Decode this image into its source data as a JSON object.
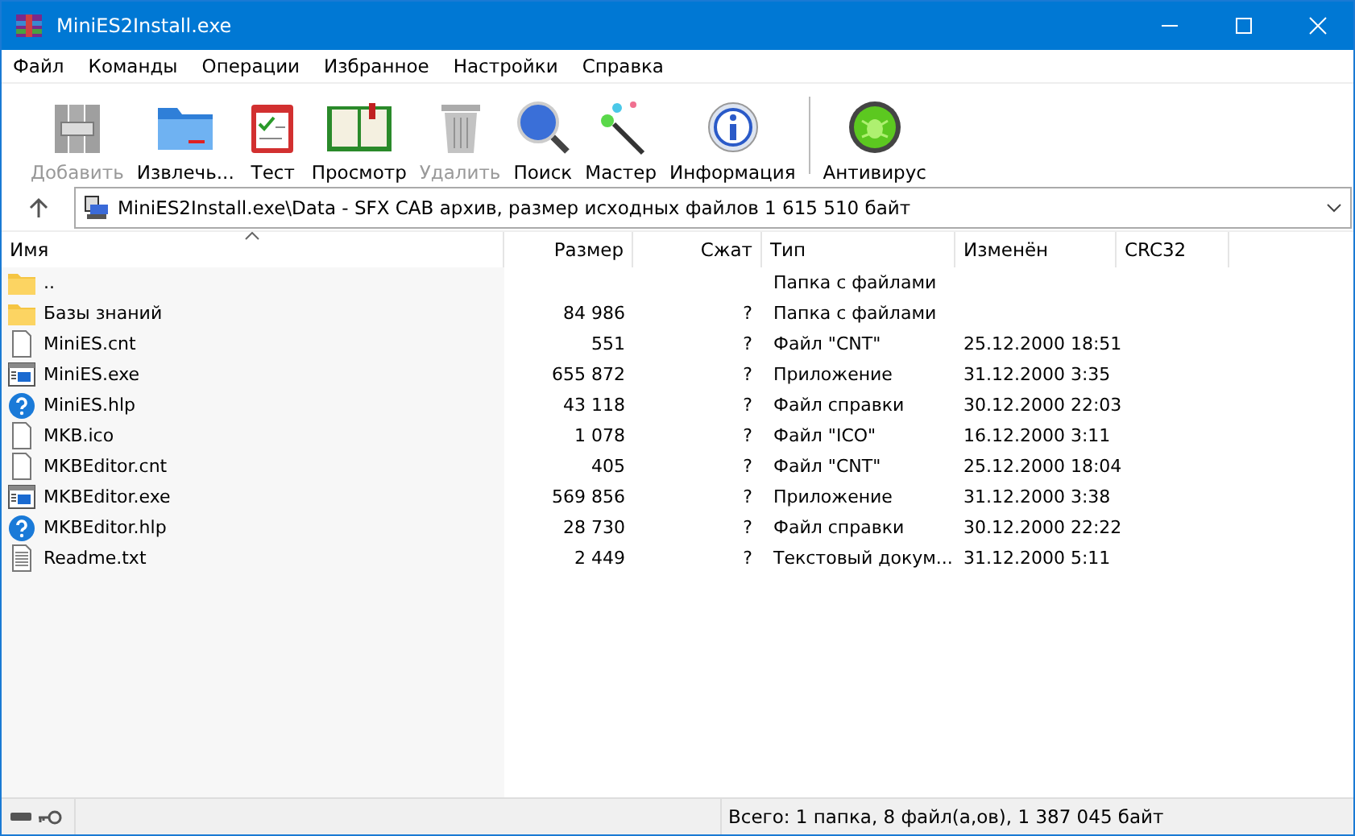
{
  "window": {
    "title": "MiniES2Install.exe"
  },
  "menu": [
    "Файл",
    "Команды",
    "Операции",
    "Избранное",
    "Настройки",
    "Справка"
  ],
  "toolbar": {
    "main": [
      {
        "kind": "add",
        "label": "Добавить",
        "disabled": true
      },
      {
        "kind": "extract",
        "label": "Извлечь...",
        "disabled": false
      },
      {
        "kind": "test",
        "label": "Тест",
        "disabled": false
      },
      {
        "kind": "view",
        "label": "Просмотр",
        "disabled": false
      },
      {
        "kind": "delete",
        "label": "Удалить",
        "disabled": true
      },
      {
        "kind": "find",
        "label": "Поиск",
        "disabled": false
      },
      {
        "kind": "wizard",
        "label": "Мастер",
        "disabled": false
      },
      {
        "kind": "info",
        "label": "Информация",
        "disabled": false
      }
    ],
    "extra": [
      {
        "kind": "antivirus",
        "label": "Антивирус",
        "disabled": false
      }
    ]
  },
  "address": {
    "value": "MiniES2Install.exe\\Data - SFX CAB архив, размер исходных файлов 1 615 510 байт"
  },
  "table": {
    "columns": [
      "Имя",
      "Размер",
      "Сжат",
      "Тип",
      "Изменён",
      "CRC32"
    ],
    "rows": [
      {
        "kind": "folder",
        "name": "..",
        "type": "Папка с файлами"
      },
      {
        "kind": "folder",
        "name": "Базы знаний",
        "size": "84 986",
        "packed": "?",
        "type": "Папка с файлами"
      },
      {
        "kind": "file",
        "name": "MiniES.cnt",
        "size": "551",
        "packed": "?",
        "type": "Файл \"CNT\"",
        "modified": "25.12.2000 18:51"
      },
      {
        "kind": "exe",
        "name": "MiniES.exe",
        "size": "655 872",
        "packed": "?",
        "type": "Приложение",
        "modified": "31.12.2000 3:35"
      },
      {
        "kind": "help",
        "name": "MiniES.hlp",
        "size": "43 118",
        "packed": "?",
        "type": "Файл справки",
        "modified": "30.12.2000 22:03"
      },
      {
        "kind": "file",
        "name": "MKB.ico",
        "size": "1 078",
        "packed": "?",
        "type": "Файл \"ICO\"",
        "modified": "16.12.2000 3:11"
      },
      {
        "kind": "file",
        "name": "MKBEditor.cnt",
        "size": "405",
        "packed": "?",
        "type": "Файл \"CNT\"",
        "modified": "25.12.2000 18:04"
      },
      {
        "kind": "exe",
        "name": "MKBEditor.exe",
        "size": "569 856",
        "packed": "?",
        "type": "Приложение",
        "modified": "31.12.2000 3:38"
      },
      {
        "kind": "help",
        "name": "MKBEditor.hlp",
        "size": "28 730",
        "packed": "?",
        "type": "Файл справки",
        "modified": "30.12.2000 22:22"
      },
      {
        "kind": "text",
        "name": "Readme.txt",
        "size": "2 449",
        "packed": "?",
        "type": "Текстовый докум...",
        "modified": "31.12.2000 5:11"
      }
    ]
  },
  "status_bar": {
    "text": "Всего: 1 папка, 8 файл(а,ов), 1 387 045 байт"
  }
}
